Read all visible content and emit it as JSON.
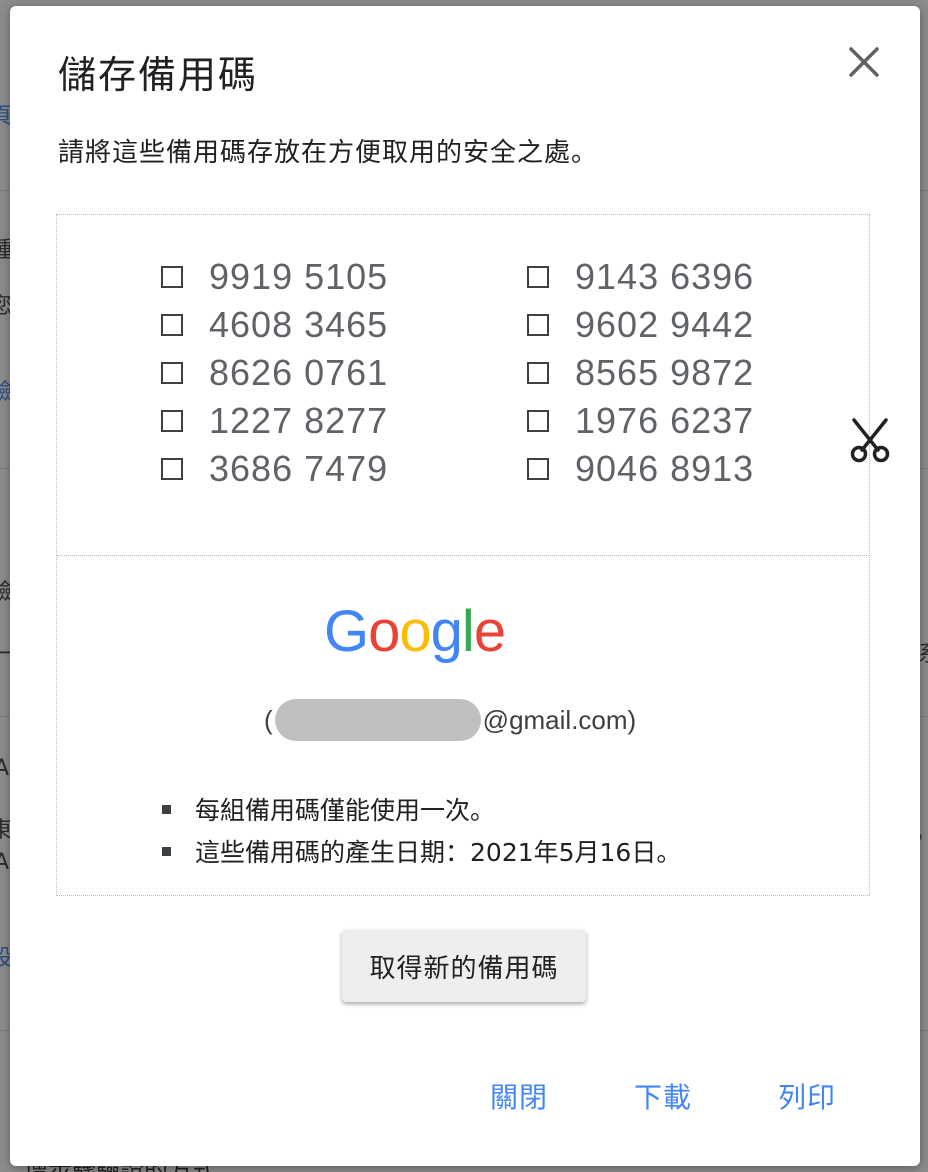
{
  "background": {
    "fragments": [
      {
        "text": "頁",
        "kind": "link"
      },
      {
        "text": "種",
        "kind": "text"
      },
      {
        "text": "您",
        "kind": "text"
      },
      {
        "text": "驗",
        "kind": "link"
      },
      {
        "text": "驗",
        "kind": "text"
      },
      {
        "text": "一",
        "kind": "text"
      },
      {
        "text": "A",
        "kind": "text"
      },
      {
        "text": "東",
        "kind": "text"
      },
      {
        "text": "A",
        "kind": "text"
      },
      {
        "text": "設",
        "kind": "link"
      },
      {
        "text": "系",
        "kind": "text"
      },
      {
        "text": "。",
        "kind": "text"
      }
    ],
    "bottom_text": "、增步驟驗證的方式"
  },
  "dialog": {
    "title": "儲存備用碼",
    "close_icon": "close-icon",
    "description": "請將這些備用碼存放在方便取用的安全之處。",
    "codes_left": [
      "9919 5105",
      "4608 3465",
      "8626 0761",
      "1227 8277",
      "3686 7479"
    ],
    "codes_right": [
      "9143 6396",
      "9602 9442",
      "8565 9872",
      "1976 6237",
      "9046 8913"
    ],
    "cut_icon": "scissors-icon",
    "brand": {
      "letters": [
        "G",
        "o",
        "o",
        "g",
        "l",
        "e"
      ],
      "colors": [
        "#4285F4",
        "#EA4335",
        "#FBBC05",
        "#4285F4",
        "#34A853",
        "#EA4335"
      ]
    },
    "email": {
      "open_paren": "(",
      "suffix": "@gmail.com)"
    },
    "notes": [
      "每組備用碼僅能使用一次。",
      "這些備用碼的產生日期：2021年5月16日。"
    ],
    "new_codes_button": "取得新的備用碼",
    "actions": {
      "close": "關閉",
      "download": "下載",
      "print": "列印"
    },
    "accent_color": "#4285F4"
  }
}
